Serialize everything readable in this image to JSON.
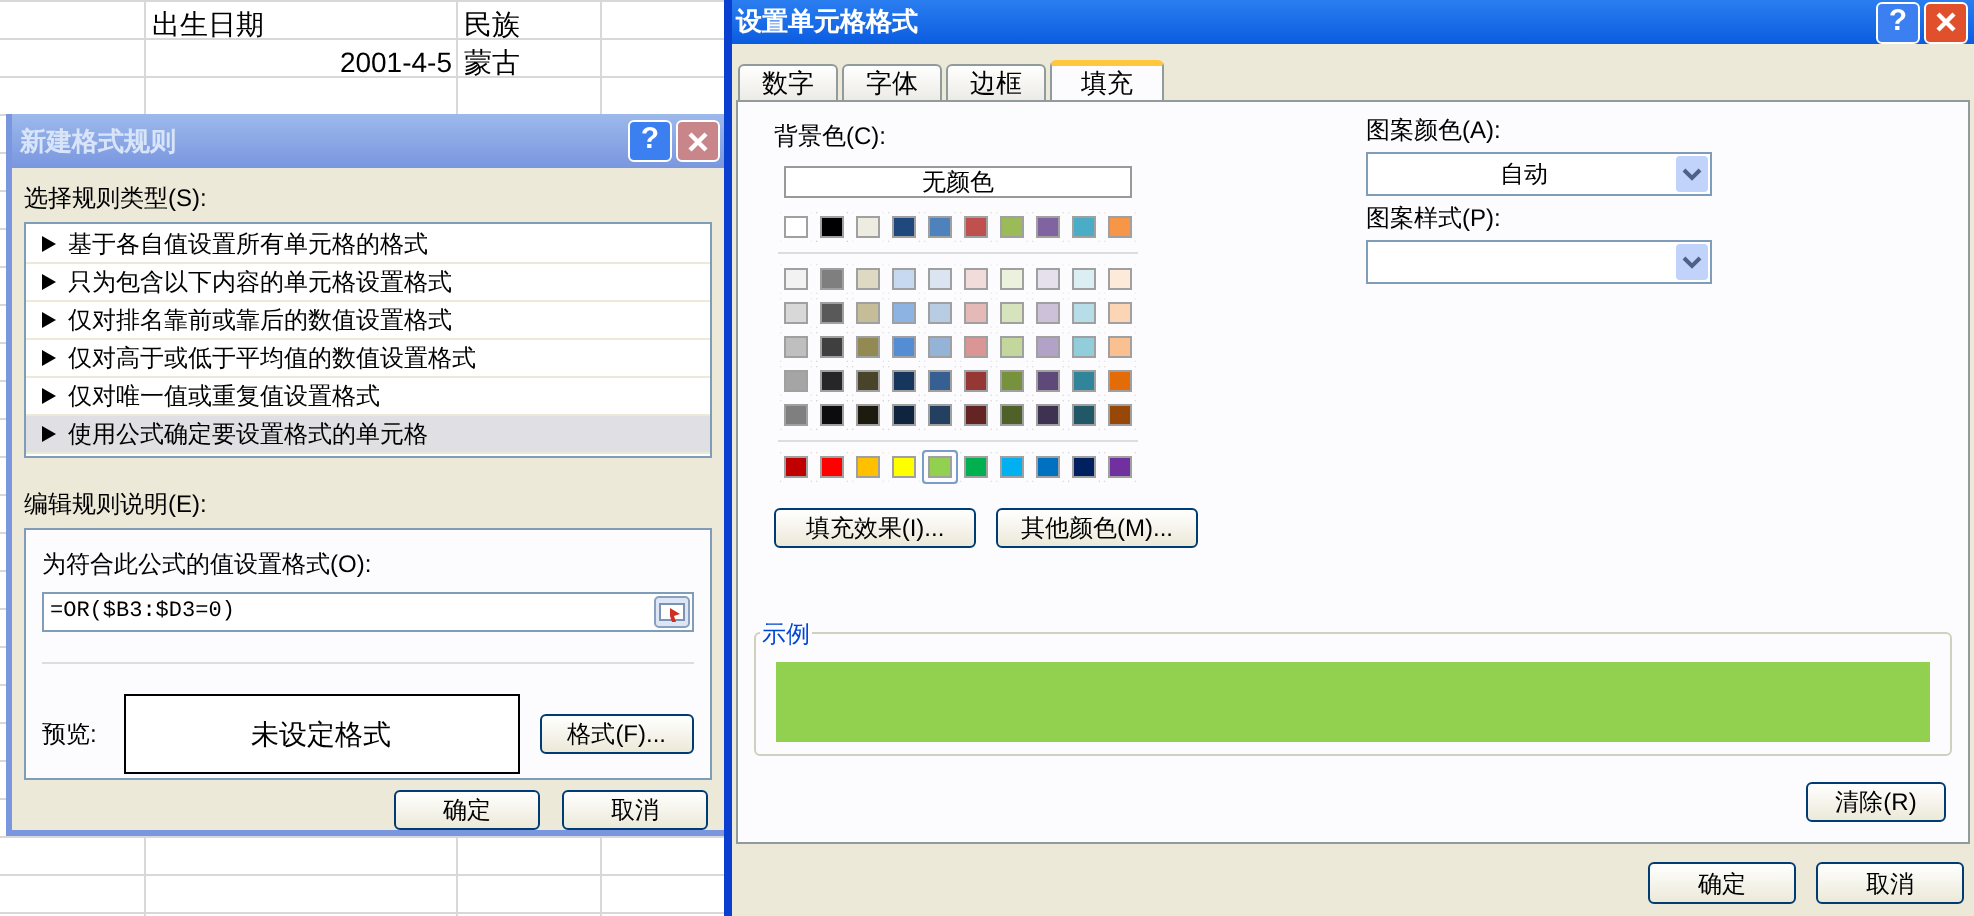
{
  "spreadsheet": {
    "rows": [
      [
        "出生日期",
        "民族"
      ],
      [
        "2001-4-5",
        "蒙古"
      ]
    ]
  },
  "new_rule_dialog": {
    "title": "新建格式规则",
    "help_button": "?",
    "rule_type_label": "选择规则类型(S):",
    "rule_types": [
      {
        "label": "基于各自值设置所有单元格的格式",
        "selected": false
      },
      {
        "label": "只为包含以下内容的单元格设置格式",
        "selected": false
      },
      {
        "label": "仅对排名靠前或靠后的数值设置格式",
        "selected": false
      },
      {
        "label": "仅对高于或低于平均值的数值设置格式",
        "selected": false
      },
      {
        "label": "仅对唯一值或重复值设置格式",
        "selected": false
      },
      {
        "label": "使用公式确定要设置格式的单元格",
        "selected": true
      }
    ],
    "description_label": "编辑规则说明(E):",
    "formula_label": "为符合此公式的值设置格式(O):",
    "formula": "=OR($B3:$D3=0)",
    "preview_label": "预览:",
    "preview_text": "未设定格式",
    "format_button": "格式(F)...",
    "ok_button": "确定",
    "cancel_button": "取消"
  },
  "format_cells_dialog": {
    "title": "设置单元格格式",
    "help_button": "?",
    "tabs": [
      {
        "label": "数字",
        "selected": false
      },
      {
        "label": "字体",
        "selected": false
      },
      {
        "label": "边框",
        "selected": false
      },
      {
        "label": "填充",
        "selected": true
      }
    ],
    "background_label": "背景色(C):",
    "no_color_button": "无颜色",
    "theme_colors": [
      {
        "color": "#ffffff",
        "selected": false
      },
      {
        "color": "#000000",
        "selected": false
      },
      {
        "color": "#eeece1",
        "selected": false
      },
      {
        "color": "#1f497d",
        "selected": false
      },
      {
        "color": "#4f81bd",
        "selected": false
      },
      {
        "color": "#c0504d",
        "selected": false
      },
      {
        "color": "#9bbb59",
        "selected": false
      },
      {
        "color": "#8064a2",
        "selected": false
      },
      {
        "color": "#4bacc6",
        "selected": false
      },
      {
        "color": "#f79646",
        "selected": false
      }
    ],
    "tint_rows": [
      [
        {
          "color": "#f2f2f2",
          "selected": false
        },
        {
          "color": "#7f7f7f",
          "selected": false
        },
        {
          "color": "#ddd9c3",
          "selected": false
        },
        {
          "color": "#c6d9f0",
          "selected": false
        },
        {
          "color": "#dbe5f1",
          "selected": false
        },
        {
          "color": "#f2dcdb",
          "selected": false
        },
        {
          "color": "#ebf1dd",
          "selected": false
        },
        {
          "color": "#e5e0ec",
          "selected": false
        },
        {
          "color": "#dbeef3",
          "selected": false
        },
        {
          "color": "#fdeada",
          "selected": false
        }
      ],
      [
        {
          "color": "#d8d8d8",
          "selected": false
        },
        {
          "color": "#595959",
          "selected": false
        },
        {
          "color": "#c4bd97",
          "selected": false
        },
        {
          "color": "#8db3e2",
          "selected": false
        },
        {
          "color": "#b8cce4",
          "selected": false
        },
        {
          "color": "#e5b9b7",
          "selected": false
        },
        {
          "color": "#d7e3bc",
          "selected": false
        },
        {
          "color": "#ccc1d9",
          "selected": false
        },
        {
          "color": "#b7dde8",
          "selected": false
        },
        {
          "color": "#fbd5b5",
          "selected": false
        }
      ],
      [
        {
          "color": "#bfbfbf",
          "selected": false
        },
        {
          "color": "#3f3f3f",
          "selected": false
        },
        {
          "color": "#938953",
          "selected": false
        },
        {
          "color": "#548dd4",
          "selected": false
        },
        {
          "color": "#95b3d7",
          "selected": false
        },
        {
          "color": "#d99694",
          "selected": false
        },
        {
          "color": "#c3d69b",
          "selected": false
        },
        {
          "color": "#b2a2c7",
          "selected": false
        },
        {
          "color": "#92cddc",
          "selected": false
        },
        {
          "color": "#fac08f",
          "selected": false
        }
      ],
      [
        {
          "color": "#a5a5a5",
          "selected": false
        },
        {
          "color": "#262626",
          "selected": false
        },
        {
          "color": "#494429",
          "selected": false
        },
        {
          "color": "#17365d",
          "selected": false
        },
        {
          "color": "#366092",
          "selected": false
        },
        {
          "color": "#953734",
          "selected": false
        },
        {
          "color": "#76923c",
          "selected": false
        },
        {
          "color": "#5f497a",
          "selected": false
        },
        {
          "color": "#31859b",
          "selected": false
        },
        {
          "color": "#e36c09",
          "selected": false
        }
      ],
      [
        {
          "color": "#7f7f7f",
          "selected": false
        },
        {
          "color": "#0c0c0c",
          "selected": false
        },
        {
          "color": "#1d1b10",
          "selected": false
        },
        {
          "color": "#0f243e",
          "selected": false
        },
        {
          "color": "#244061",
          "selected": false
        },
        {
          "color": "#632423",
          "selected": false
        },
        {
          "color": "#4f6128",
          "selected": false
        },
        {
          "color": "#3f3151",
          "selected": false
        },
        {
          "color": "#205867",
          "selected": false
        },
        {
          "color": "#974806",
          "selected": false
        }
      ]
    ],
    "standard_colors": [
      {
        "color": "#c00000",
        "selected": false
      },
      {
        "color": "#ff0000",
        "selected": false
      },
      {
        "color": "#ffc000",
        "selected": false
      },
      {
        "color": "#ffff00",
        "selected": false
      },
      {
        "color": "#92d050",
        "selected": true
      },
      {
        "color": "#00b050",
        "selected": false
      },
      {
        "color": "#00b0f0",
        "selected": false
      },
      {
        "color": "#0070c0",
        "selected": false
      },
      {
        "color": "#002060",
        "selected": false
      },
      {
        "color": "#7030a0",
        "selected": false
      }
    ],
    "fill_effects_button": "填充效果(I)...",
    "more_colors_button": "其他颜色(M)...",
    "pattern_color_label": "图案颜色(A):",
    "pattern_color": "自动",
    "pattern_style_label": "图案样式(P):",
    "sample_label": "示例",
    "clear_button": "清除(R)",
    "ok_button": "确定",
    "cancel_button": "取消"
  }
}
